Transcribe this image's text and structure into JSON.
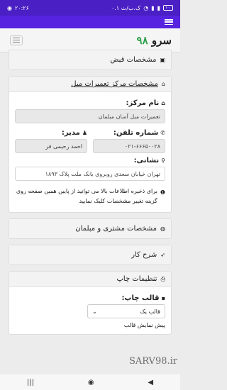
{
  "status_bar": {
    "time": "۲۰:۲۶",
    "speed": "۰.۱ ک.ب/ث",
    "battery": "۱۰۰"
  },
  "brand": {
    "text": "سرو",
    "number": "۹۸"
  },
  "sections": {
    "receipt": {
      "title": "مشخصات قبض"
    },
    "repair_center": {
      "title": "مشخصات مرکز تعمیرات مبل",
      "center_name_label": "نام مرکز:",
      "center_name_value": "تعمیرات مبل آسان مبلمان",
      "phone_label": "شماره تلفن:",
      "phone_value": "۰۲۱-۶۶۶۵۰۰۲۸",
      "manager_label": "مدیر:",
      "manager_value": "احمد رحیمی فر",
      "address_label": "نشانی:",
      "address_value": "تهران خیابان سعدی روبروی بانک ملت پلاک ۱۸۹۳",
      "info_text": "برای ذخیره اطلاعات بالا می توانید از پایین همین صفحه روی گزینه تغییر مشخصات کلیک نمایید"
    },
    "customer": {
      "title": "مشخصات مشتری و مبلمان"
    },
    "job": {
      "title": "شرح کار"
    },
    "print": {
      "title": "تنظیمات چاپ",
      "template_label": "قالب چاپ:",
      "template_value": "قالب یک",
      "preview_label": "پیش نمایش قالب"
    }
  },
  "watermark": "SARV98.ir",
  "icons": [
    "wifi-icon",
    "signal-icon",
    "hamburger-icon",
    "receipt-icon",
    "home-icon",
    "user-icon",
    "phone-icon",
    "map-marker-icon",
    "info-icon",
    "user-circle-icon",
    "rocket-icon",
    "print-icon",
    "template-icon",
    "chevron-down-icon"
  ]
}
